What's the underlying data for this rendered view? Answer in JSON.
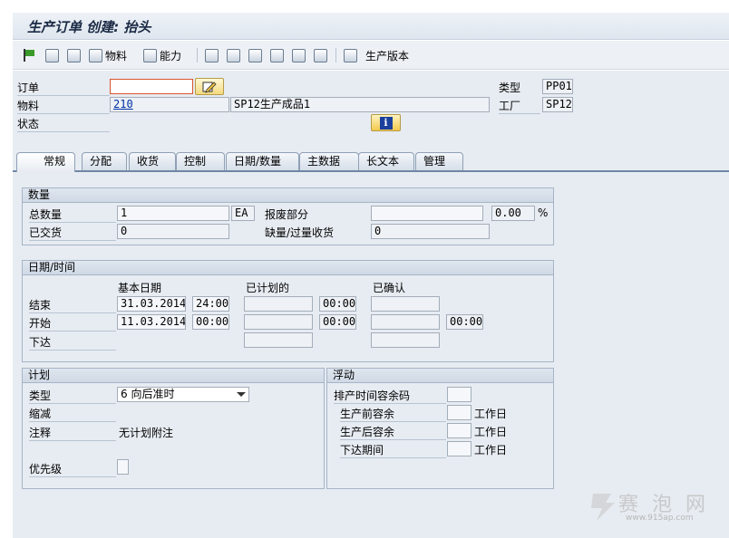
{
  "window_title": "生产订单 创建: 抬头",
  "toolbar": {
    "material_label": "物料",
    "capacity_label": "能力",
    "production_version_label": "生产版本"
  },
  "header": {
    "order_label": "订单",
    "order_value": "",
    "material_label": "物料",
    "material_value": "210",
    "material_desc": "SP12生产成品1",
    "status_label": "状态",
    "type_label": "类型",
    "type_value": "PP01",
    "plant_label": "工厂",
    "plant_value": "SP12"
  },
  "tabs": [
    "常规",
    "分配",
    "收货",
    "控制",
    "日期/数量",
    "主数据",
    "长文本",
    "管理"
  ],
  "quantity": {
    "title": "数量",
    "total_label": "总数量",
    "total_value": "1",
    "unit": "EA",
    "scrap_label": "报废部分",
    "scrap_value": "",
    "scrap_pct": "0.00",
    "pct_sign": "%",
    "delivered_label": "已交货",
    "delivered_value": "0",
    "shortage_label": "缺量/过量收货",
    "shortage_value": "0"
  },
  "dates": {
    "title": "日期/时间",
    "col_basic": "基本日期",
    "col_scheduled": "已计划的",
    "col_confirmed": "已确认",
    "end_label": "结束",
    "end_date": "31.03.2014",
    "end_time": "24:00",
    "end_sched_time": "00:00",
    "start_label": "开始",
    "start_date": "11.03.2014",
    "start_time": "00:00",
    "start_sched_time": "00:00",
    "start_conf_time": "00:00",
    "release_label": "下达"
  },
  "planning": {
    "title": "计划",
    "type_label": "类型",
    "type_value": "6 向后准时",
    "reduction_label": "缩减",
    "note_label": "注释",
    "note_value": "无计划附注",
    "priority_label": "优先级"
  },
  "float": {
    "title": "浮动",
    "sched_margin_label": "排产时间容余码",
    "float_before_label": "生产前容余",
    "float_after_label": "生产后容余",
    "release_period_label": "下达期间",
    "workday_unit": "工作日"
  },
  "watermark": {
    "text": "赛 泡 网",
    "url": "www.915ap.com"
  }
}
